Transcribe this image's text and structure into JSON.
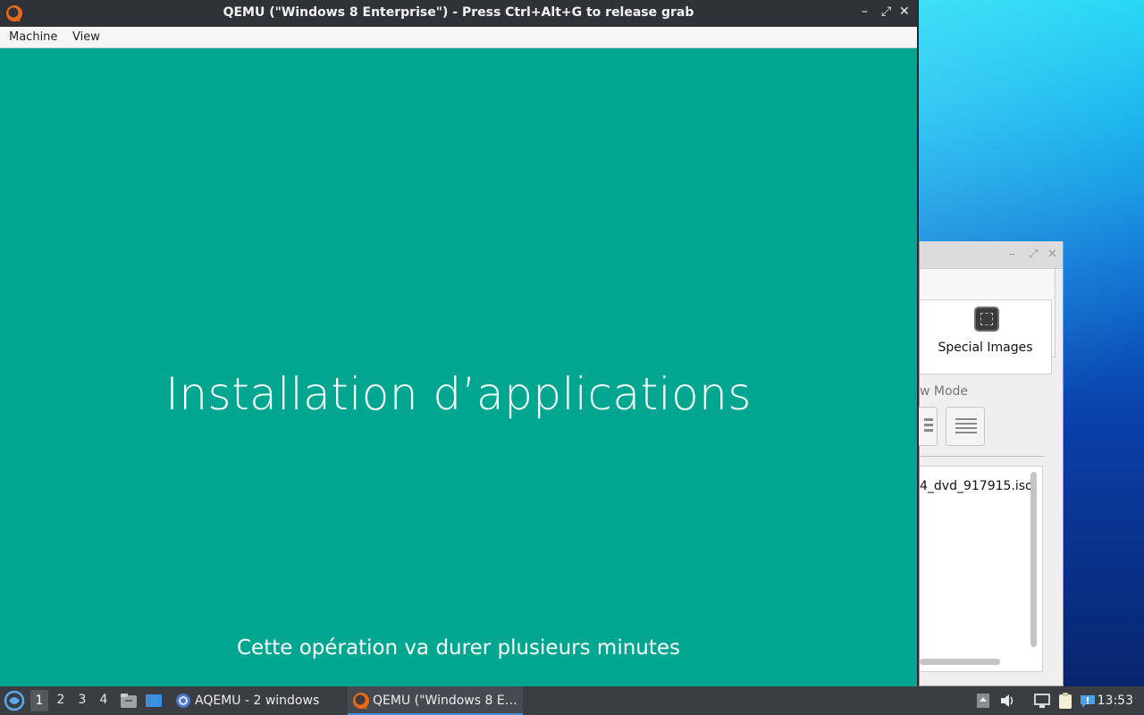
{
  "qemu_window": {
    "title": "QEMU (\"Windows 8 Enterprise\") - Press Ctrl+Alt+G to release grab",
    "controls": {
      "minimize": "–",
      "restore": "⤢",
      "close": "✕"
    },
    "menu": [
      "Machine",
      "View"
    ],
    "guest_screen": {
      "background": "#00a690",
      "heading": "Installation d’applications",
      "subtitle": "Cette opération va durer plusieurs minutes"
    }
  },
  "aqemu_window": {
    "controls": {
      "minimize": "–",
      "restore": "⤢",
      "close": "✕"
    },
    "special_images_label": "Special Images",
    "view_mode_label": "w Mode",
    "file_name": "4_dvd_917915.iso"
  },
  "taskbar": {
    "desktops": [
      "1",
      "2",
      "3",
      "4"
    ],
    "active_desktop": "1",
    "tasks": [
      {
        "label": "AQEMU - 2 windows",
        "icon": "aqemu-icon"
      },
      {
        "label": "QEMU (\"Windows 8 E…",
        "icon": "qemu-icon"
      }
    ],
    "clock": "13:53"
  },
  "colors": {
    "guest_accent": "#00a690",
    "titlebar": "#2f3338",
    "taskbar": "#3a3d42",
    "active_task_underline": "#3d8fe0"
  }
}
